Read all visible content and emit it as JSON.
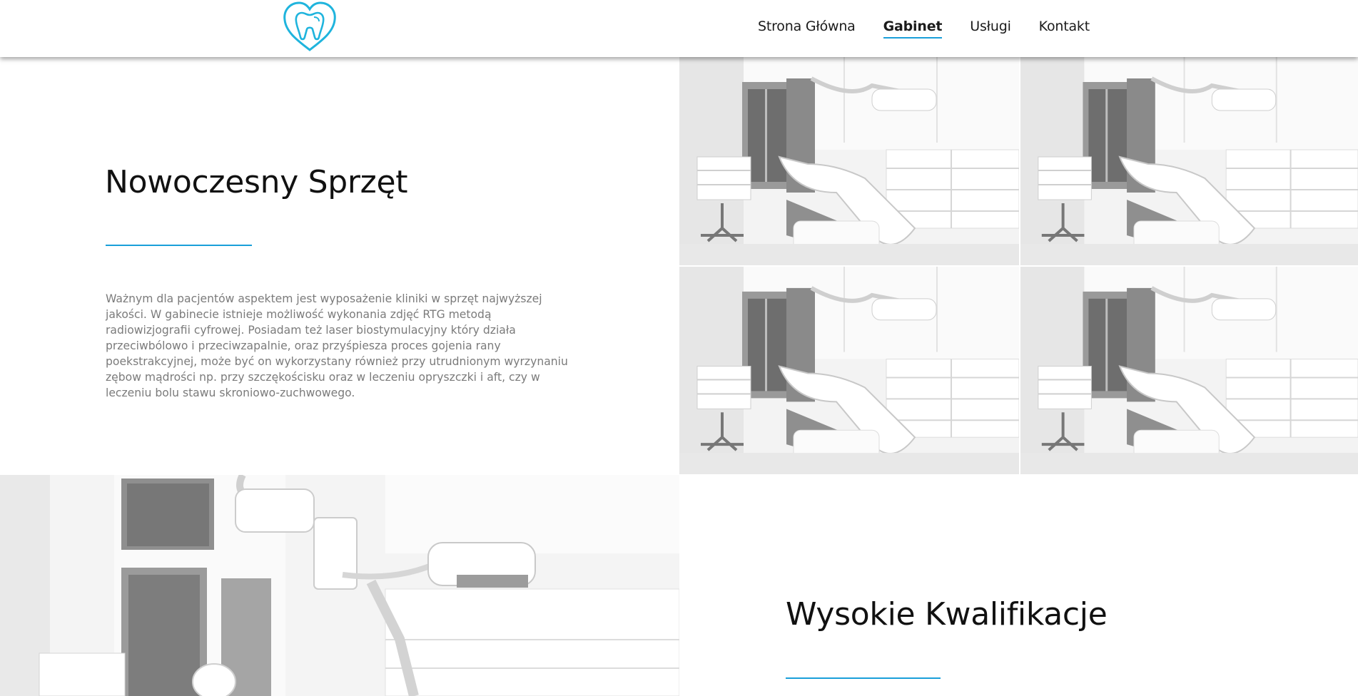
{
  "header": {
    "logo": {
      "icon": "tooth-heart-icon",
      "color": "#1fb4dd"
    },
    "nav": [
      {
        "label": "Strona Główna",
        "active": false
      },
      {
        "label": "Gabinet",
        "active": true
      },
      {
        "label": "Usługi",
        "active": false
      },
      {
        "label": "Kontakt",
        "active": false
      }
    ]
  },
  "section_equipment": {
    "title": "Nowoczesny Sprzęt",
    "body": "Ważnym dla pacjentów aspektem jest wyposażenie kliniki w sprzęt najwyższej jakości. W gabinecie istnieje możliwość wykonania zdjęć RTG metodą radiowizjografii cyfrowej. Posiadam też laser biostymulacyjny który działa przeciwbólowo i przeciwzapalnie, oraz przyśpiesza proces gojenia rany poekstrakcyjnej, może być on wykorzystany również przy utrudnionym wyrzynaniu zębow mądrości np. przy szczękościsku oraz w leczeniu opryszczki i aft, czy w leczeniu bolu stawu skroniowo-zuchwowego.",
    "gallery": [
      "dental-office-photo",
      "dental-office-photo",
      "dental-office-photo",
      "dental-office-photo"
    ]
  },
  "section_qualifications": {
    "title": "Wysokie Kwalifikacje",
    "image": "dental-office-photo"
  },
  "colors": {
    "accent": "#1a9fd9",
    "heading": "#111111",
    "text": "#7b7b7b"
  }
}
